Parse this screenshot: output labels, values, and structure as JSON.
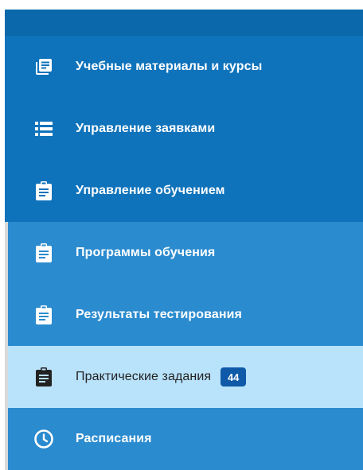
{
  "sidebar": {
    "items": [
      {
        "label": "Учебные материалы и курсы",
        "icon": "library-books-icon"
      },
      {
        "label": "Управление заявками",
        "icon": "list-icon"
      },
      {
        "label": "Управление обучением",
        "icon": "clipboard-icon"
      },
      {
        "label": "Программы обучения",
        "icon": "clipboard-icon"
      },
      {
        "label": "Результаты тестирования",
        "icon": "clipboard-icon"
      },
      {
        "label": "Практические задания",
        "icon": "clipboard-icon",
        "badge": "44",
        "active": true
      },
      {
        "label": "Расписания",
        "icon": "clock-icon"
      }
    ]
  },
  "colors": {
    "primary": "#0f73bb",
    "topbar": "#0b68aa",
    "submenu": "#2b8bcf",
    "active": "#b9e2fb",
    "badge": "#0f5aa8"
  }
}
